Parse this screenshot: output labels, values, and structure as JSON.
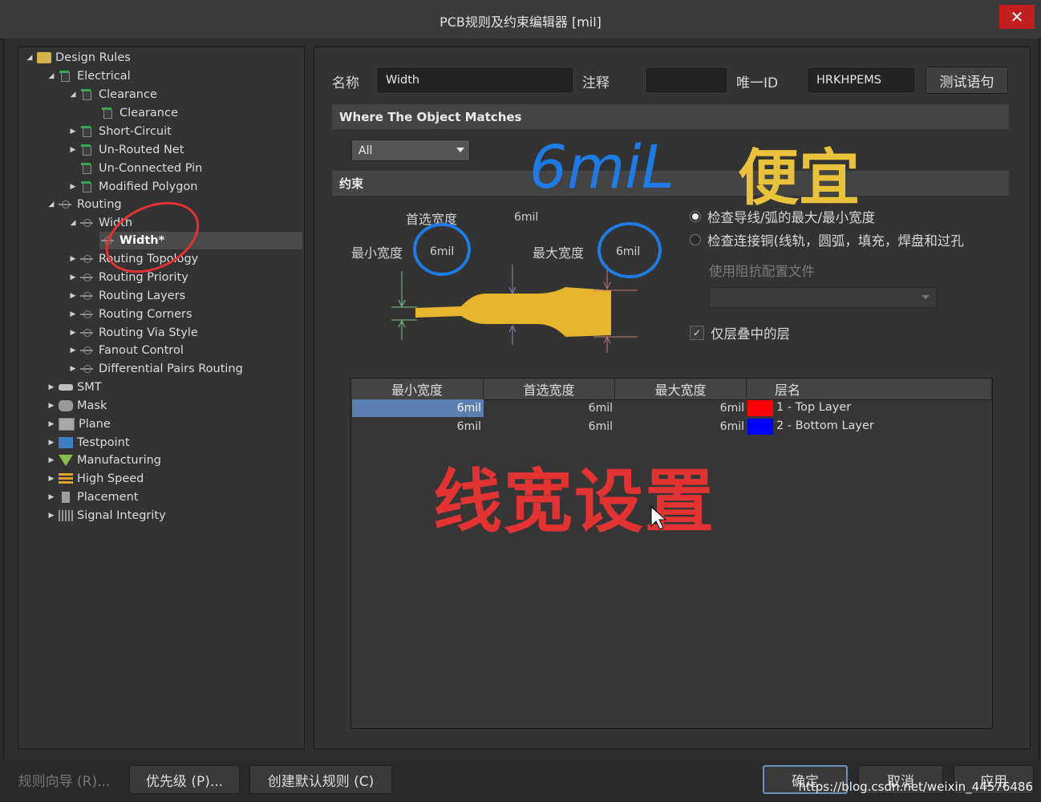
{
  "window": {
    "title": "PCB规则及约束编辑器 [mil]",
    "close_glyph": "✕"
  },
  "tree": {
    "root": "Design Rules",
    "electrical": "Electrical",
    "clearance_group": "Clearance",
    "clearance_rule": "Clearance",
    "short_circuit": "Short-Circuit",
    "unrouted_net": "Un-Routed Net",
    "unconnected_pin": "Un-Connected Pin",
    "modified_polygon": "Modified Polygon",
    "routing": "Routing",
    "width_group": "Width",
    "width_rule": "Width*",
    "routing_topology": "Routing Topology",
    "routing_priority": "Routing Priority",
    "routing_layers": "Routing Layers",
    "routing_corners": "Routing Corners",
    "routing_via_style": "Routing Via Style",
    "fanout_control": "Fanout Control",
    "diff_pairs_routing": "Differential Pairs Routing",
    "smt": "SMT",
    "mask": "Mask",
    "plane": "Plane",
    "testpoint": "Testpoint",
    "manufacturing": "Manufacturing",
    "high_speed": "High Speed",
    "placement": "Placement",
    "signal_integrity": "Signal Integrity"
  },
  "header": {
    "name_label": "名称",
    "name_value": "Width",
    "comment_label": "注释",
    "comment_value": "",
    "uid_label": "唯一ID",
    "uid_value": "HRKHPEMS",
    "test_button": "测试语句"
  },
  "match": {
    "section_title": "Where The Object Matches",
    "scope_value": "All"
  },
  "constraints": {
    "section_title": "约束",
    "preferred_label": "首选宽度",
    "preferred_value": "6mil",
    "min_label": "最小宽度",
    "min_value": "6mil",
    "max_label": "最大宽度",
    "max_value": "6mil",
    "radio_1": "检查导线/弧的最大/最小宽度",
    "radio_2": "检查连接铜(线轨，圆弧，填充，焊盘和过孔",
    "impedance_label": "使用阻抗配置文件",
    "stack_layers_label": "仅层叠中的层",
    "check_glyph": "✓"
  },
  "table": {
    "headers": [
      "最小宽度",
      "首选宽度",
      "最大宽度",
      "层名"
    ],
    "rows": [
      {
        "min": "6mil",
        "pref": "6mil",
        "max": "6mil",
        "color": "#ff0000",
        "layer": "1 - Top Layer"
      },
      {
        "min": "6mil",
        "pref": "6mil",
        "max": "6mil",
        "color": "#0000ff",
        "layer": "2 - Bottom Layer"
      }
    ]
  },
  "annotations": {
    "blue_note": "6miL",
    "yellow_note": "便宜",
    "red_note": "线宽设置"
  },
  "footer": {
    "wizard": "规则向导 (R)...",
    "priority": "优先级 (P)...",
    "create_default": "创建默认规则 (C)",
    "ok": "确定",
    "cancel": "取消",
    "apply": "应用",
    "watermark": "https://blog.csdn.net/weixin_44576486"
  },
  "colors": {
    "track": "#e6b52c",
    "annotation_blue": "#1e7be6",
    "annotation_red": "#e23232",
    "annotation_yellow": "#e8c23a"
  }
}
